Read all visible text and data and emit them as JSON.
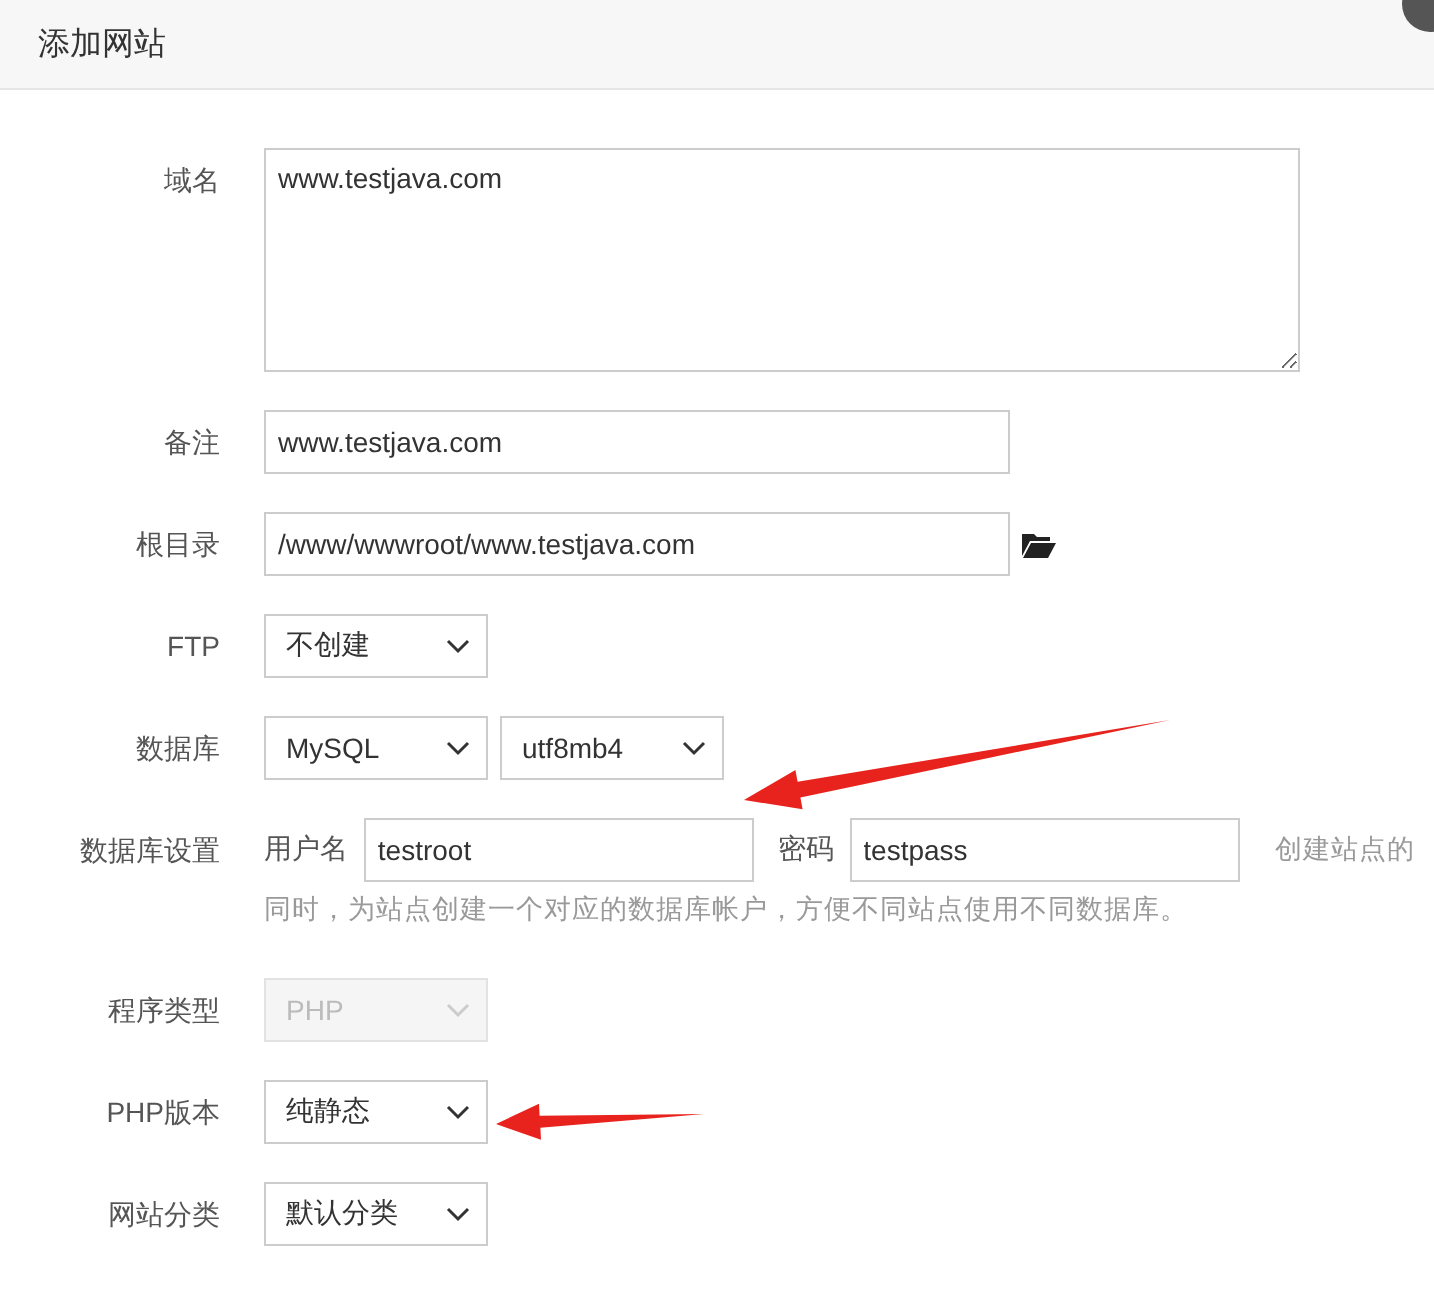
{
  "dialog": {
    "title": "添加网站"
  },
  "fields": [
    {
      "kind": "textarea",
      "label": "域名",
      "value": "www.testjava.com"
    },
    {
      "kind": "input",
      "label": "备注",
      "value": "www.testjava.com"
    },
    {
      "kind": "path",
      "label": "根目录",
      "value": "/www/wwwroot/www.testjava.com"
    },
    {
      "kind": "select",
      "label": "FTP",
      "selects": [
        {
          "value": "不创建",
          "disabled": false
        }
      ]
    },
    {
      "kind": "select",
      "label": "数据库",
      "selects": [
        {
          "value": "MySQL",
          "disabled": false
        },
        {
          "value": "utf8mb4",
          "disabled": false
        }
      ]
    },
    {
      "kind": "credentials",
      "label": "数据库设置",
      "user_label": "用户名",
      "user": "testroot",
      "password_label": "密码",
      "password": "testpass",
      "hint_lines": [
        "创建站点的",
        "同时，为站点创建一个对应的数据库帐户，方便不同站点使用不同数据库。"
      ]
    },
    {
      "kind": "select",
      "label": "程序类型",
      "selects": [
        {
          "value": "PHP",
          "disabled": true
        }
      ]
    },
    {
      "kind": "select",
      "label": "PHP版本",
      "selects": [
        {
          "value": "纯静态",
          "disabled": false
        }
      ]
    },
    {
      "kind": "select",
      "label": "网站分类",
      "selects": [
        {
          "value": "默认分类",
          "disabled": false
        }
      ]
    }
  ]
}
